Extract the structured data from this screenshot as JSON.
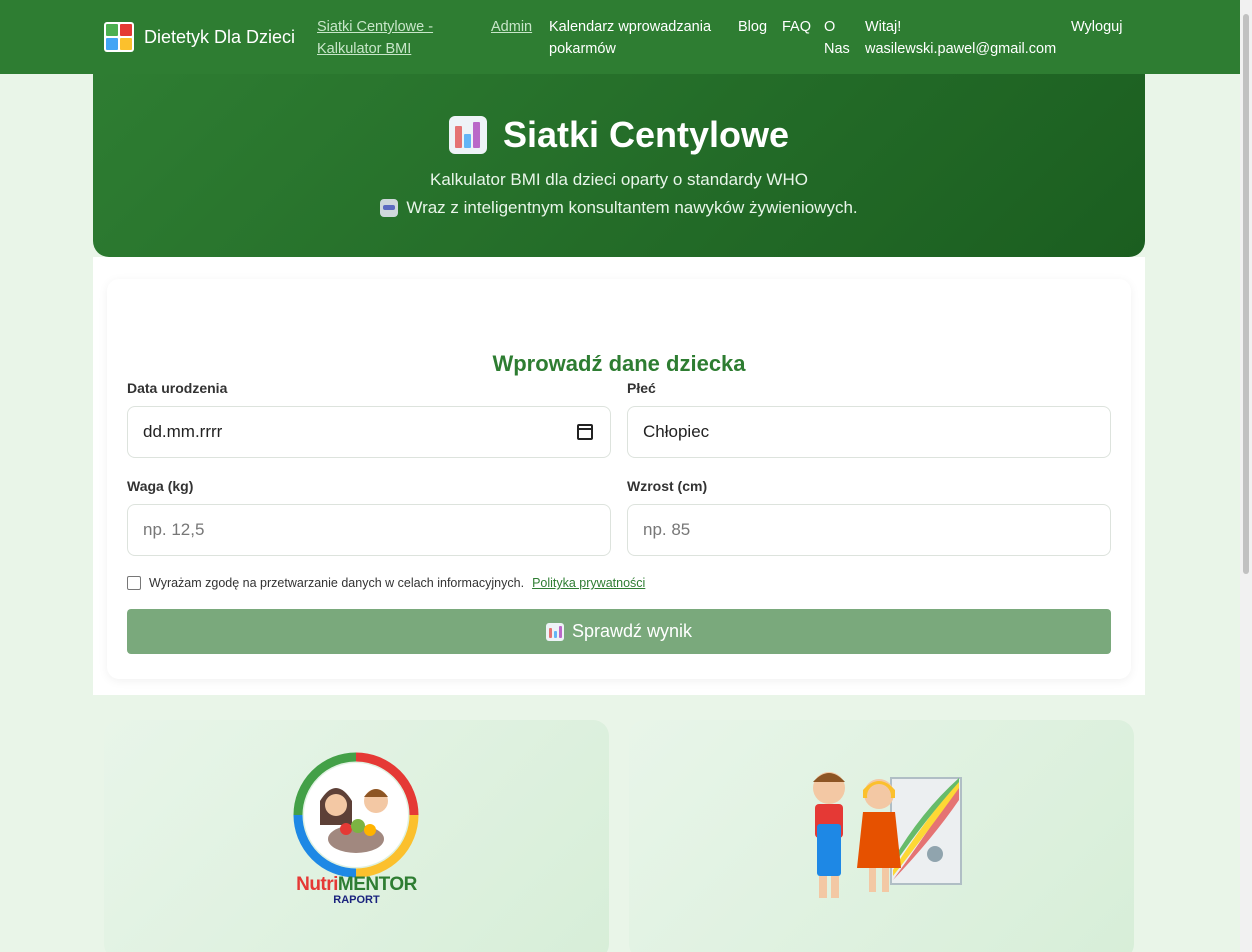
{
  "nav": {
    "brand": "Dietetyk Dla Dzieci",
    "siatki_line1": "Siatki Centylowe -",
    "siatki_line2": "Kalkulator BMI",
    "admin": "Admin",
    "calendar_line1": "Kalendarz wprowadzania",
    "calendar_line2": "pokarmów",
    "blog": "Blog",
    "faq": "FAQ",
    "about_line1": "O",
    "about_line2": "Nas",
    "welcome_line1": "Witaj!",
    "welcome_line2": "wasilewski.pawel@gmail.com",
    "logout": "Wyloguj"
  },
  "hero": {
    "title": "Siatki Centylowe",
    "subtitle": "Kalkulator BMI dla dzieci oparty o standardy WHO",
    "subtitle2": "Wraz z inteligentnym konsultantem nawyków żywieniowych."
  },
  "form": {
    "title": "Wprowadź dane dziecka",
    "birthdate_label": "Data urodzenia",
    "birthdate_placeholder": "dd.mm.rrrr",
    "sex_label": "Płeć",
    "sex_value": "Chłopiec",
    "weight_label": "Waga (kg)",
    "weight_placeholder": "np. 12,5",
    "height_label": "Wzrost (cm)",
    "height_placeholder": "np. 85",
    "consent_text": "Wyrażam zgodę na przetwarzanie danych w celach informacyjnych.",
    "privacy_link": "Polityka prywatności",
    "submit_label": "Sprawdź wynik"
  },
  "promo": {
    "left_brand_1": "Nutri",
    "left_brand_2": "MENTOR",
    "left_brand_sub": "RAPORT"
  },
  "icons": {
    "chart": "chart-icon",
    "robot": "robot-icon",
    "calendar": "calendar-icon"
  },
  "colors": {
    "primary": "#2e7d32",
    "primary_dark": "#1b5e20",
    "button_disabled": "#7aa97c",
    "page_bg": "#e9f5e8"
  }
}
